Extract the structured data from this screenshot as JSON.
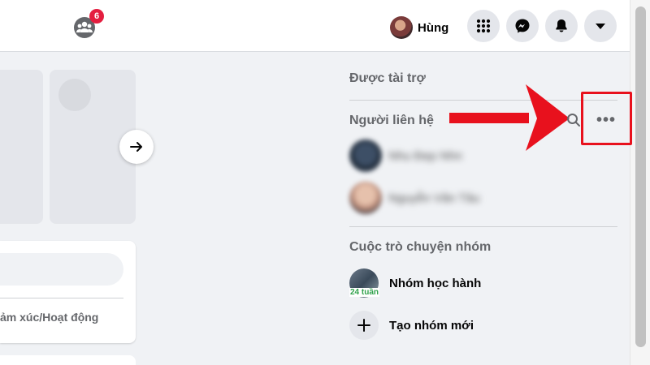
{
  "header": {
    "groups_badge": "6",
    "profile_name": "Hùng",
    "icons": [
      "groups-icon",
      "menu-grid-icon",
      "messenger-icon",
      "notifications-bell-icon",
      "account-dropdown-icon"
    ]
  },
  "feed": {
    "composer_feeling_label": "ảm xúc/Hoạt động"
  },
  "right_rail": {
    "sponsored_title": "Được tài trợ",
    "contacts_title": "Người liên hệ",
    "contacts": [
      {
        "name": "Nhu Đẹp Nhn"
      },
      {
        "name": "Nguyễn Văn Tâu"
      }
    ],
    "group_chats_title": "Cuộc trò chuyện nhóm",
    "group_chats": [
      {
        "name": "Nhóm học hành",
        "last_active": "24 tuần"
      }
    ],
    "create_group_label": "Tạo nhóm mới"
  },
  "annotation": {
    "color": "#e8111d",
    "target": "contacts-options-button"
  },
  "colors": {
    "badge": "#e41e3f",
    "active_green": "#31a24c",
    "secondary_text": "#65676b"
  }
}
